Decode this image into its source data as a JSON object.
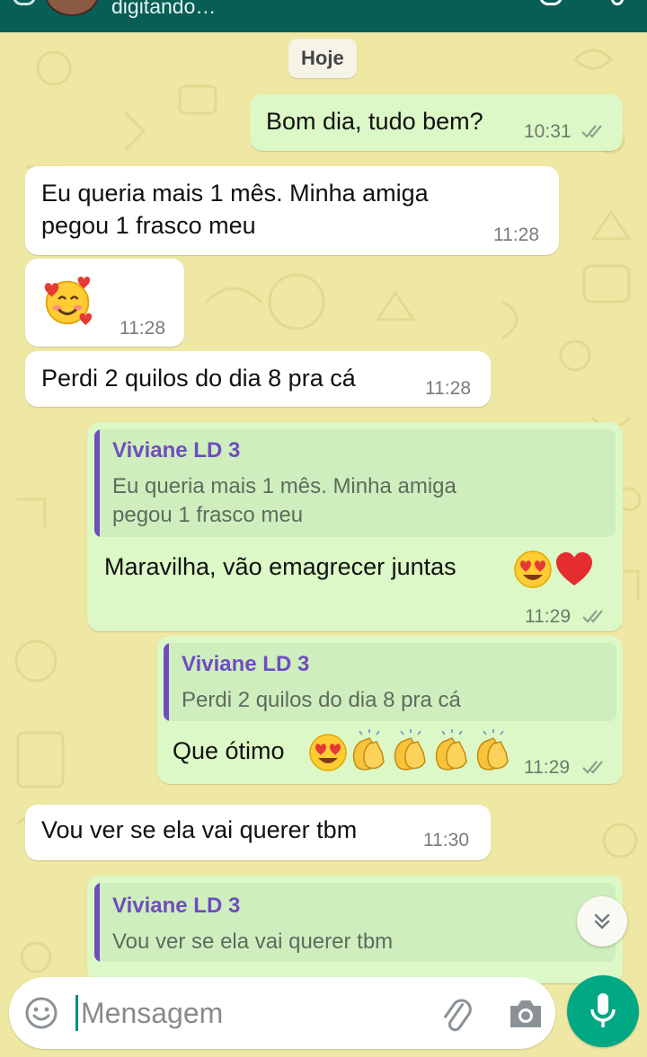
{
  "header": {
    "contact_status": "digitando…"
  },
  "date_divider": "Hoje",
  "messages": [
    {
      "direction": "out",
      "text": "Bom dia, tudo bem?",
      "time": "10:31",
      "status": "read"
    },
    {
      "direction": "in",
      "lines": [
        "Eu queria mais 1 mês.  Minha amiga",
        "pegou 1 frasco meu"
      ],
      "time": "11:28"
    },
    {
      "direction": "in",
      "emoji": "smiling-face-with-hearts",
      "time": "11:28"
    },
    {
      "direction": "in",
      "text": "Perdi 2 quilos do dia 8 pra cá",
      "time": "11:28"
    },
    {
      "direction": "out",
      "quote": {
        "author": "Viviane LD 3",
        "lines": [
          "Eu queria mais 1 mês.  Minha amiga",
          "pegou 1 frasco meu"
        ]
      },
      "text": "Maravilha, vão emagrecer juntas",
      "emojis": [
        "heart-eyes",
        "red-heart"
      ],
      "time": "11:29",
      "status": "read"
    },
    {
      "direction": "out",
      "quote": {
        "author": "Viviane LD 3",
        "lines": [
          "Perdi 2 quilos do dia 8 pra cá"
        ]
      },
      "text": "Que ótimo",
      "emojis": [
        "heart-eyes",
        "clapping-hands",
        "clapping-hands",
        "clapping-hands",
        "clapping-hands"
      ],
      "time": "11:29",
      "status": "read"
    },
    {
      "direction": "in",
      "text": "Vou ver se ela vai querer tbm",
      "time": "11:30"
    },
    {
      "direction": "out",
      "quote": {
        "author": "Viviane LD 3",
        "lines": [
          "Vou ver se ela vai querer tbm"
        ]
      }
    }
  ],
  "composer": {
    "placeholder": "Mensagem",
    "icons": [
      "emoji-icon",
      "attach-icon",
      "camera-icon",
      "mic-icon"
    ]
  },
  "colors": {
    "wallpaper": "#efe7a4",
    "outgoing_bubble": "#dcf8c6",
    "incoming_bubble": "#ffffff",
    "quote_accent": "#6f4dc1",
    "mic_button": "#00a884",
    "header": "#075e54"
  }
}
